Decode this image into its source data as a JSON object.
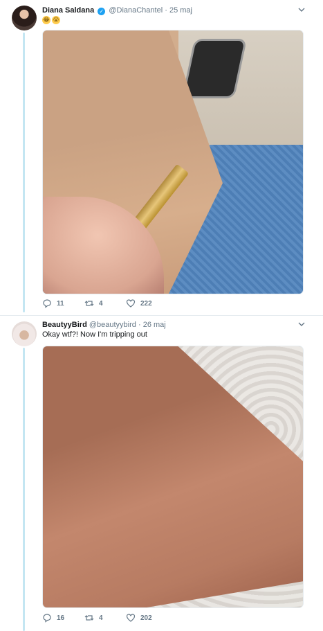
{
  "tweets": [
    {
      "display_name": "Diana Saldana",
      "verified": true,
      "handle": "@DianaChantel",
      "separator": "·",
      "date": "25 maj",
      "text": "",
      "emojis": [
        "😂",
        "😮"
      ],
      "stats": {
        "replies": "11",
        "retweets": "4",
        "likes": "222"
      }
    },
    {
      "display_name": "BeautyyBird",
      "verified": false,
      "handle": "@beautyybird",
      "separator": "·",
      "date": "26 maj",
      "text": "Okay wtf?! Now I'm tripping out",
      "emojis": [],
      "stats": {
        "replies": "16",
        "retweets": "4",
        "likes": "202"
      }
    }
  ],
  "icons": {
    "reply": "reply-icon",
    "retweet": "retweet-icon",
    "like": "like-icon",
    "menu": "chevron-down-icon",
    "verified": "verified-badge-icon"
  },
  "colors": {
    "thread_line": "#c4e6f2",
    "secondary_text": "#657786",
    "verified": "#1da1f2"
  }
}
